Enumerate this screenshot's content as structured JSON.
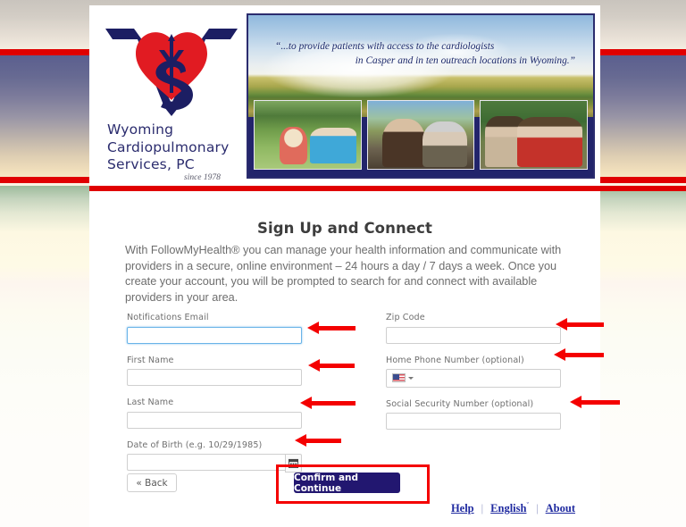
{
  "header": {
    "logo_alt": "wcs-caduceus-logo",
    "org_name": "Wyoming\nCardiopulmonary\nServices, PC",
    "since": "since 1978",
    "banner_quote_line1": "“...to provide patients with access to the cardiologists",
    "banner_quote_line2": "in Casper and in ten outreach locations in Wyoming.”",
    "photos": [
      "photo-grandfather-and-toddler",
      "photo-senior-couple",
      "photo-three-senior-women"
    ]
  },
  "main": {
    "title": "Sign Up and Connect",
    "intro": "With FollowMyHealth® you can manage your health information and communicate with providers in a secure, online environment – 24 hours a day / 7 days a week. Once you create your account, you will be prompted to search for and connect with available providers in your area."
  },
  "form": {
    "left": [
      {
        "name": "notifications-email",
        "label": "Notifications Email",
        "value": "",
        "placeholder": "",
        "focused": true
      },
      {
        "name": "first-name",
        "label": "First Name",
        "value": "",
        "placeholder": "",
        "focused": false
      },
      {
        "name": "last-name",
        "label": "Last Name",
        "value": "",
        "placeholder": "",
        "focused": false
      },
      {
        "name": "date-of-birth",
        "label": "Date of Birth (e.g. 10/29/1985)",
        "value": "",
        "placeholder": "",
        "focused": false
      }
    ],
    "right": [
      {
        "name": "zip-code",
        "label": "Zip Code",
        "value": "",
        "placeholder": "",
        "focused": false
      },
      {
        "name": "home-phone-number",
        "label": "Home Phone Number (optional)",
        "value": "",
        "placeholder": "",
        "focused": false
      },
      {
        "name": "social-security-number",
        "label": "Social Security Number (optional)",
        "value": "",
        "placeholder": "",
        "focused": false
      }
    ],
    "calendar_icon": "calendar-icon",
    "country_flag": "us-flag-icon",
    "country_caret": "chevron-down-icon"
  },
  "actions": {
    "back_label": "« Back",
    "confirm_label": "Confirm and Continue"
  },
  "footer": {
    "help": "Help",
    "language": "English",
    "language_caret": "ˇ",
    "about": "About",
    "separator": "|"
  },
  "colors": {
    "brand_navy": "#2b2c6e",
    "brand_red": "#e00000",
    "annotation_red": "#f40000",
    "button_navy": "#221770",
    "link_blue": "#1f2aa0",
    "focus_blue": "#6ab4e8"
  }
}
